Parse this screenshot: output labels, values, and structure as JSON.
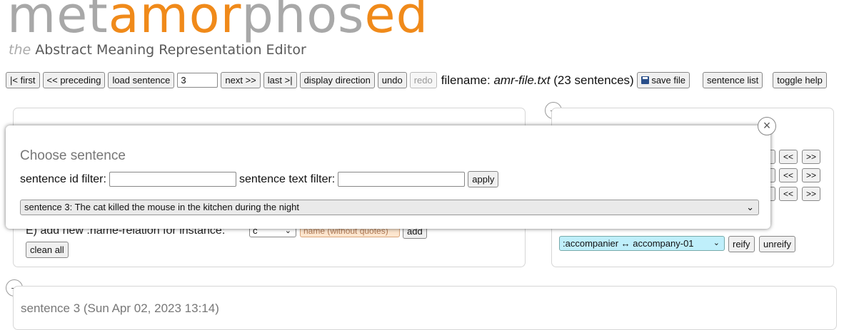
{
  "logo": {
    "part1": "met",
    "part2": "amor",
    "part3": "phos",
    "part4": "ed"
  },
  "subtitle": {
    "the": "the",
    "text": "Abstract Meaning Representation Editor"
  },
  "toolbar": {
    "first": "|< first",
    "preceding": "<< preceding",
    "load_sentence": "load sentence",
    "sentence_number": "3",
    "next": "next >>",
    "last": "last >|",
    "display_direction": "display direction",
    "undo": "undo",
    "redo": "redo",
    "filename_label": "filename:",
    "filename": "amr-file.txt",
    "sentence_count": "(23 sentences)",
    "save_file": "save file",
    "sentence_list": "sentence list",
    "toggle_help": "toggle help"
  },
  "left_panel": {
    "add_name_label": "E)   add new :name-relation for instance:",
    "instance_value": "c",
    "name_placeholder": "name (without quotes)",
    "add": "add",
    "clean_all": "clean all"
  },
  "right_panel": {
    "prev": "<<",
    "next": ">>",
    "reify_select": ":accompanier ↔ accompany-01",
    "reify": "reify",
    "unreify": "unreify"
  },
  "bottom_panel": {
    "sentence_header": "sentence 3 (Sun Apr 02, 2023 13:14)"
  },
  "modal": {
    "title": "Choose sentence",
    "id_filter_label": "sentence id filter:",
    "text_filter_label": "sentence text filter:",
    "apply": "apply",
    "selected_sentence": "sentence 3: The cat killed the mouse in the kitchen during the night",
    "close": "×"
  },
  "colors": {
    "brand_orange": "#f08a1a",
    "brand_grey": "#a8a8a8",
    "reify_select_bg": "#bfeffb",
    "name_input_bg": "#fde6cf"
  }
}
